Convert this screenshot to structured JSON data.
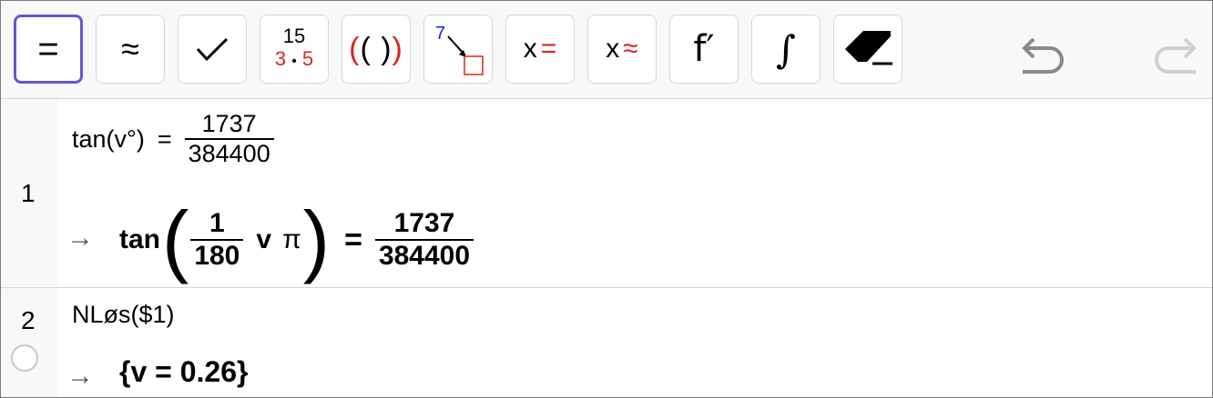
{
  "toolbar": {
    "evaluate_symbol": "=",
    "numeric_symbol": "≈",
    "keep_input_symbol": "✓",
    "factor_top": "15",
    "factor_bottom_a": "3",
    "factor_dot": "•",
    "factor_bottom_b": "5",
    "expand_left": "(",
    "expand_mid": "( )",
    "expand_right": ")",
    "substitute_num": "7",
    "solve_x": "x",
    "solve_eq": "=",
    "nsolve_x": "x",
    "nsolve_approx": "≈",
    "derivative_symbol": "f′",
    "integral_symbol": "∫"
  },
  "rows": [
    {
      "number": "1",
      "input_lhs": "tan(v°)",
      "input_eq": "=",
      "input_num": "1737",
      "input_den": "384400",
      "arrow": "→",
      "out_fn": "tan",
      "out_inner_num": "1",
      "out_inner_den": "180",
      "out_var": "v",
      "out_pi": "π",
      "out_eq": "=",
      "out_num": "1737",
      "out_den": "384400"
    },
    {
      "number": "2",
      "input": "NLøs($1)",
      "arrow": "→",
      "output": "{v = 0.26}"
    }
  ]
}
